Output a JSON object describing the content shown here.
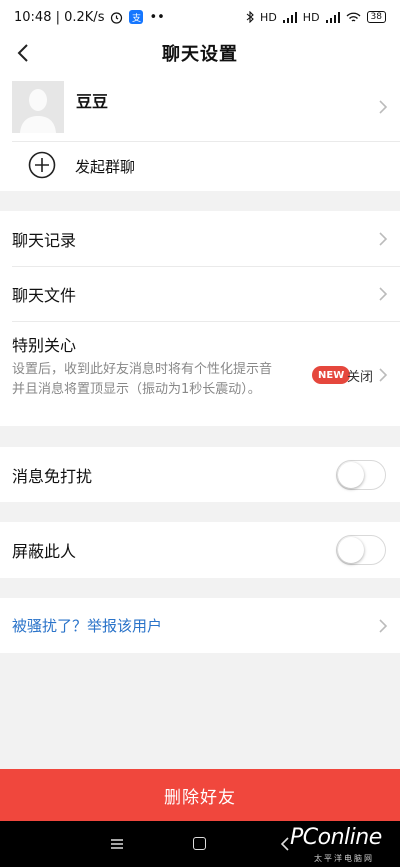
{
  "status_bar": {
    "time_speed": "10:48 | 0.2K/s",
    "app_icon_text": "支",
    "dots": "••",
    "signal_1": "HD",
    "signal_2": "HD",
    "battery": "38"
  },
  "header": {
    "title": "聊天设置",
    "back_icon": "chevron-left-icon"
  },
  "profile": {
    "name": "豆豆",
    "avatar_icon": "default-avatar-icon"
  },
  "group_chat": {
    "label": "发起群聊",
    "icon": "plus-circle-icon"
  },
  "menu": {
    "chat_history": "聊天记录",
    "chat_files": "聊天文件"
  },
  "special_care": {
    "title": "特别关心",
    "description": "设置后，收到此好友消息时将有个性化提示音并且消息将置顶显示（振动为1秒长震动）。",
    "badge": "NEW",
    "state": "关闭"
  },
  "toggles": {
    "do_not_disturb": {
      "label": "消息免打扰",
      "on": false
    },
    "block": {
      "label": "屏蔽此人",
      "on": false
    }
  },
  "report": {
    "label": "被骚扰了？举报该用户"
  },
  "delete_button": {
    "label": "删除好友"
  },
  "watermark": {
    "brand": "PConline",
    "tagline": "太平洋电脑网"
  },
  "colors": {
    "accent_red": "#f0473d",
    "link_blue": "#2a73c9",
    "background": "#f2f2f2"
  }
}
